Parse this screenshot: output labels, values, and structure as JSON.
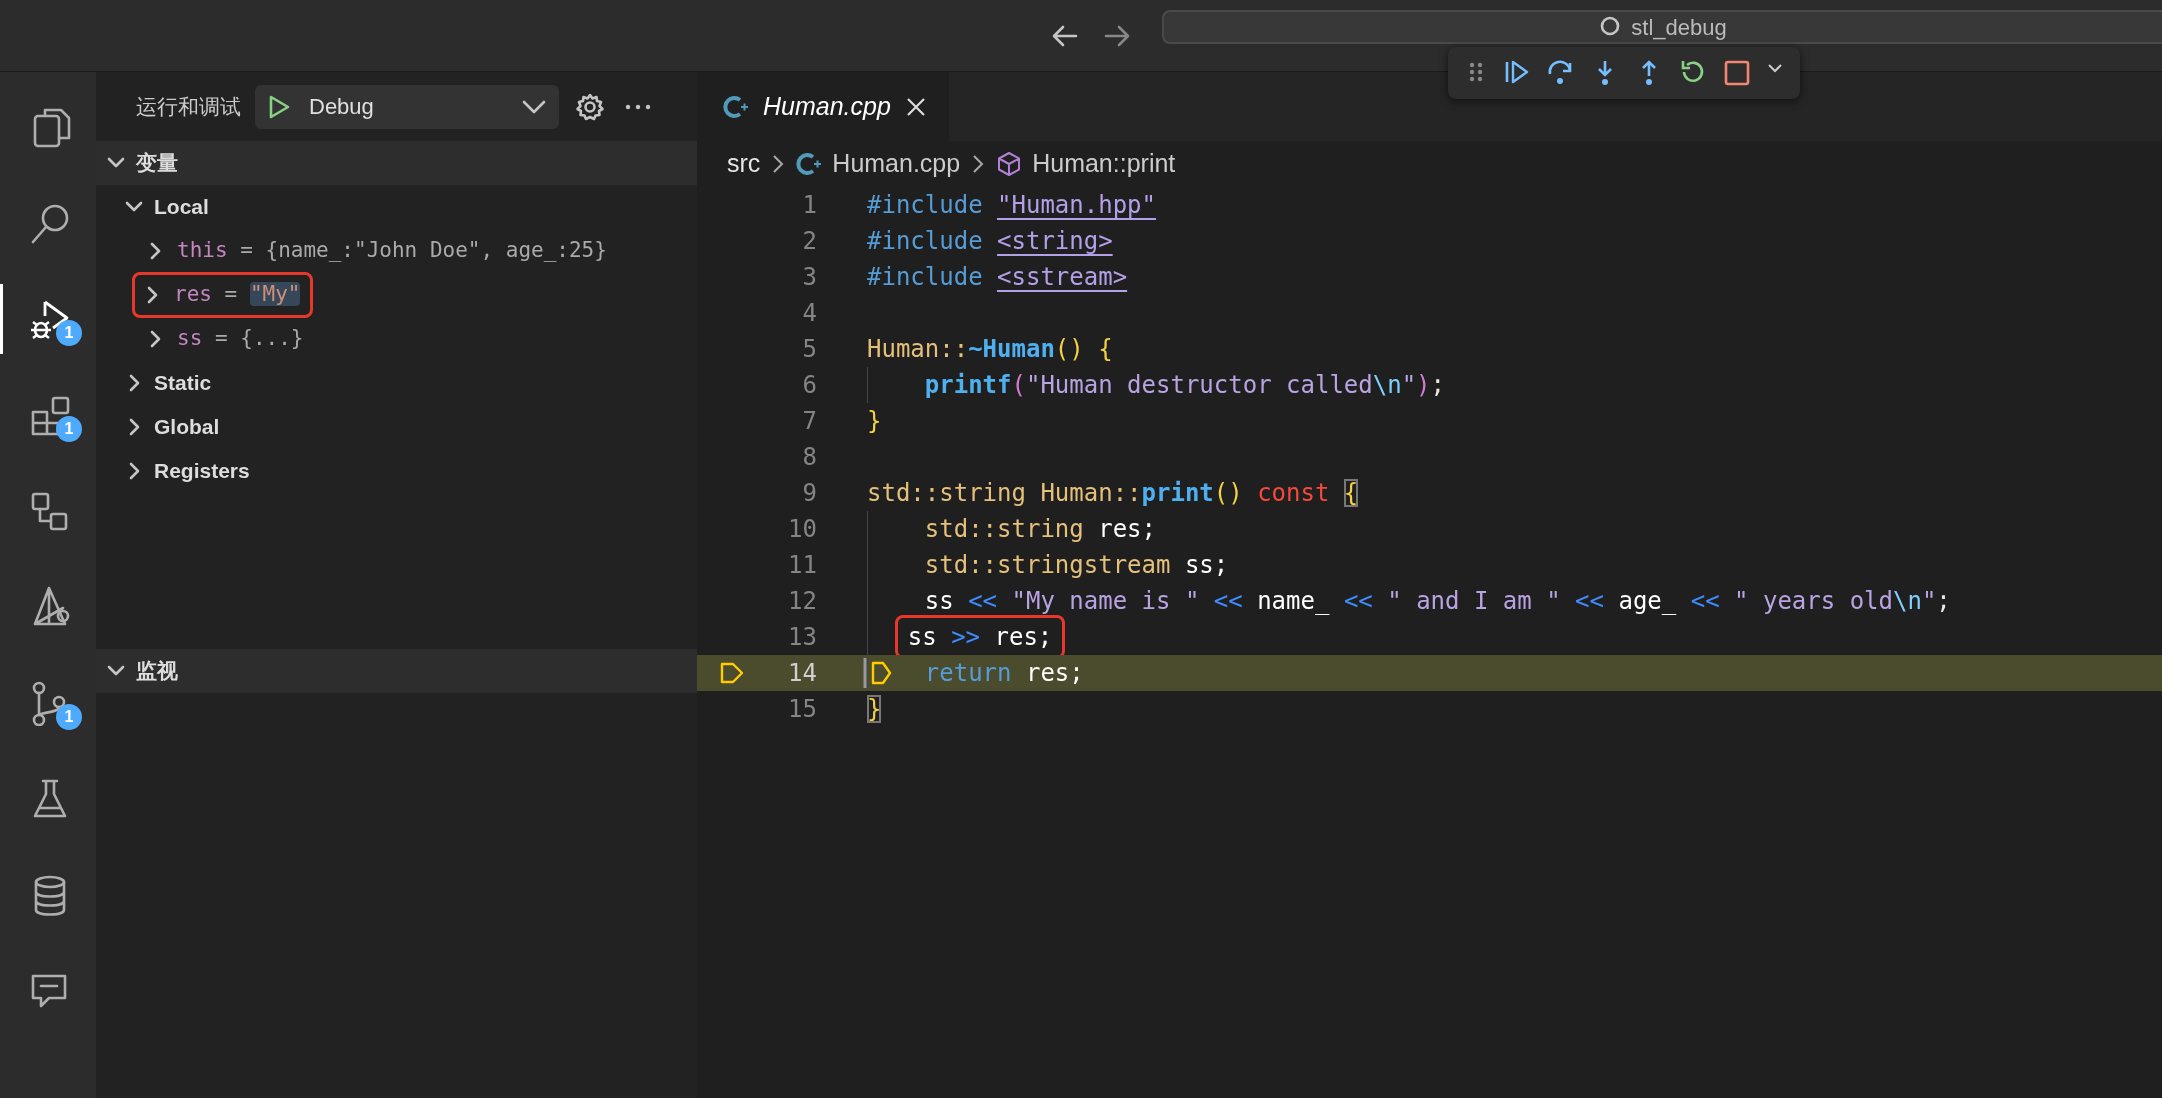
{
  "title_bar": {
    "search": {
      "value": "stl_debug"
    }
  },
  "activity_bar": {
    "items": [
      {
        "kind": "files",
        "selected": false
      },
      {
        "kind": "search",
        "selected": false
      },
      {
        "kind": "run",
        "selected": true,
        "badge": "1"
      },
      {
        "kind": "extensions",
        "selected": false,
        "badge": "1"
      },
      {
        "kind": "remote",
        "selected": false
      },
      {
        "kind": "sail",
        "selected": false
      },
      {
        "kind": "branch",
        "selected": false,
        "badge": "1"
      },
      {
        "kind": "flask",
        "selected": false
      },
      {
        "kind": "database",
        "selected": false
      },
      {
        "kind": "chat",
        "selected": false
      }
    ]
  },
  "sidebar": {
    "title": "运行和调试",
    "config": "Debug",
    "sections": [
      {
        "title": "变量",
        "expanded": true,
        "groups": [
          {
            "label": "Local",
            "expanded": true,
            "children": [
              {
                "name": "this",
                "operator": "=",
                "value": "{name_:\"John Doe\", age_:25}",
                "kind": "object",
                "expanded": false
              },
              {
                "name": "res",
                "operator": "=",
                "value": "\"My\"",
                "kind": "string",
                "expanded": false,
                "annotated": true,
                "changed": true
              },
              {
                "name": "ss",
                "operator": "=",
                "value": "{...}",
                "kind": "object",
                "expanded": false
              }
            ]
          },
          {
            "label": "Static",
            "expanded": false
          },
          {
            "label": "Global",
            "expanded": false
          },
          {
            "label": "Registers",
            "expanded": false
          }
        ]
      },
      {
        "title": "监视",
        "expanded": true
      }
    ]
  },
  "editor": {
    "tabs": [
      {
        "label": "Human.cpp",
        "selected": true,
        "preview": true
      }
    ],
    "breadcrumbs": [
      {
        "label": "src",
        "kind": "folder"
      },
      {
        "label": "Human.cpp",
        "kind": "file"
      },
      {
        "label": "Human::print",
        "kind": "symbol"
      }
    ],
    "lines": [
      {
        "number": "1",
        "tokens": [
          {
            "text": "#include ",
            "kind": "directive"
          },
          {
            "text": "\"Human.hpp\"",
            "kind": "include"
          }
        ]
      },
      {
        "number": "2",
        "tokens": [
          {
            "text": "#include ",
            "kind": "directive"
          },
          {
            "text": "<string>",
            "kind": "include"
          }
        ]
      },
      {
        "number": "3",
        "tokens": [
          {
            "text": "#include ",
            "kind": "directive"
          },
          {
            "text": "<sstream>",
            "kind": "include"
          }
        ]
      },
      {
        "number": "4"
      },
      {
        "number": "5",
        "tokens": [
          {
            "text": "Human::",
            "kind": "type"
          },
          {
            "text": "~Human",
            "kind": "func"
          },
          {
            "text": "() {",
            "kind": "brace"
          }
        ]
      },
      {
        "number": "6",
        "indented": true,
        "tokens": [
          {
            "text": "printf",
            "kind": "func"
          },
          {
            "text": "(",
            "kind": "paren"
          },
          {
            "text": "\"Human destructor called",
            "kind": "string"
          },
          {
            "text": "\\n",
            "kind": "escape"
          },
          {
            "text": "\"",
            "kind": "string"
          },
          {
            "text": ")",
            "kind": "paren"
          },
          {
            "text": ";",
            "kind": "punct"
          }
        ]
      },
      {
        "number": "7",
        "tokens": [
          {
            "text": "}",
            "kind": "brace"
          }
        ]
      },
      {
        "number": "8"
      },
      {
        "number": "9",
        "tokens": [
          {
            "text": "std::string ",
            "kind": "type"
          },
          {
            "text": "Human::",
            "kind": "type"
          },
          {
            "text": "print",
            "kind": "func"
          },
          {
            "text": "() ",
            "kind": "brace"
          },
          {
            "text": "const ",
            "kind": "keyword"
          },
          {
            "text": "{",
            "kind": "brace-match"
          }
        ]
      },
      {
        "number": "10",
        "indented": true,
        "tokens": [
          {
            "text": "std::string ",
            "kind": "type"
          },
          {
            "text": "res;",
            "kind": "ident"
          }
        ]
      },
      {
        "number": "11",
        "indented": true,
        "tokens": [
          {
            "text": "std::stringstream ",
            "kind": "type"
          },
          {
            "text": "ss;",
            "kind": "ident"
          }
        ]
      },
      {
        "number": "12",
        "indented": true,
        "tokens": [
          {
            "text": "ss ",
            "kind": "ident"
          },
          {
            "text": "<< ",
            "kind": "op"
          },
          {
            "text": "\"My name is \" ",
            "kind": "string"
          },
          {
            "text": "<< ",
            "kind": "op"
          },
          {
            "text": "name_ ",
            "kind": "ident"
          },
          {
            "text": "<< ",
            "kind": "op"
          },
          {
            "text": "\" and I am \" ",
            "kind": "string"
          },
          {
            "text": "<< ",
            "kind": "op"
          },
          {
            "text": "age_ ",
            "kind": "ident"
          },
          {
            "text": "<< ",
            "kind": "op"
          },
          {
            "text": "\" years old",
            "kind": "string"
          },
          {
            "text": "\\n",
            "kind": "escape"
          },
          {
            "text": "\"",
            "kind": "string"
          },
          {
            "text": ";",
            "kind": "punct"
          }
        ]
      },
      {
        "number": "13",
        "annotated": true,
        "indented": true,
        "tokens": [
          {
            "text": "ss ",
            "kind": "ident"
          },
          {
            "text": ">> ",
            "kind": "op"
          },
          {
            "text": "res;",
            "kind": "ident"
          }
        ]
      },
      {
        "number": "14",
        "current": true,
        "indented": true,
        "tokens": [
          {
            "text": "return ",
            "kind": "directive"
          },
          {
            "text": "res;",
            "kind": "ident"
          }
        ]
      },
      {
        "number": "15",
        "tokens": [
          {
            "text": "}",
            "kind": "brace-match"
          }
        ]
      }
    ]
  }
}
